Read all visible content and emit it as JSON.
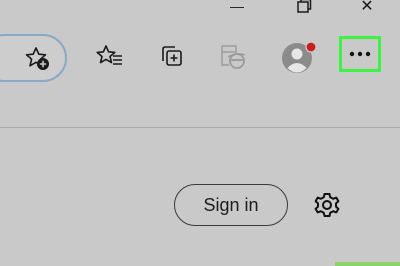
{
  "window": {
    "minimize_glyph": "—",
    "close_glyph": "✕"
  },
  "toolbar": {
    "icons": [
      "add-favorite-icon",
      "favorites-icon",
      "collections-icon",
      "ie-mode-icon",
      "profile-avatar",
      "more-menu-icon"
    ],
    "notification_dot_color": "#c81e1e",
    "highlight_color": "#3ff23f"
  },
  "content": {
    "sign_in_label": "Sign in"
  }
}
